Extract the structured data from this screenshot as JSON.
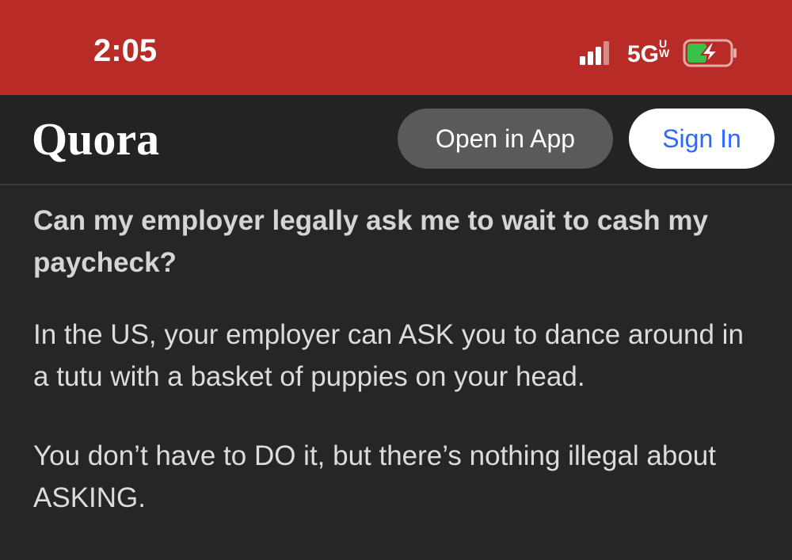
{
  "status_bar": {
    "time": "2:05",
    "network": "5G",
    "network_suffix": "UW",
    "signal_icon": "cellular-signal-icon",
    "battery_icon": "battery-charging-icon",
    "background_color": "#b92b27"
  },
  "header": {
    "logo": "Quora",
    "open_in_app_label": "Open in App",
    "sign_in_label": "Sign In",
    "sign_in_color": "#2e69ff"
  },
  "post": {
    "question": "Can my employer legally ask me to wait to cash my paycheck?",
    "paragraphs": [
      "In the US, your employer can ASK you to dance around in a tutu with a basket of puppies on your head.",
      "You don’t have to DO it, but there’s nothing illegal about ASKING."
    ]
  }
}
